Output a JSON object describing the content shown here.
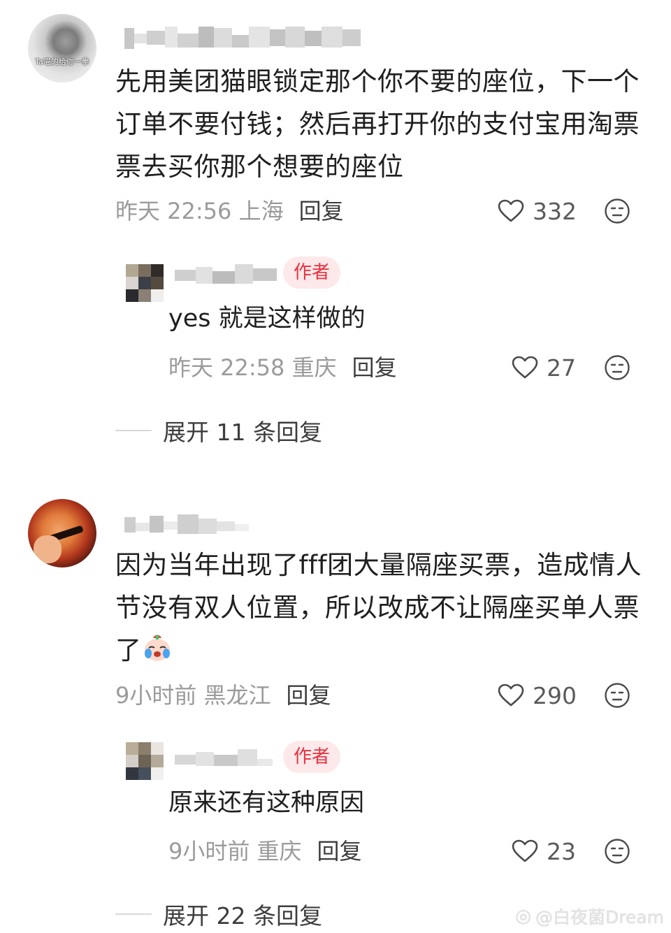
{
  "comments": [
    {
      "avatar_label": "Ta喵的给你一拳",
      "text_lines": [
        "先用美团猫眼锁定那个你不要的座位，下一个",
        "订单不要付钱；然后再打开你的支付宝用淘票",
        "票去买你那个想要的座位"
      ],
      "time": "昨天 22:56 上海",
      "reply_label": "回复",
      "likes": "332",
      "reply": {
        "badge": "作者",
        "text": "yes 就是这样做的",
        "time": "昨天 22:58 重庆",
        "reply_label": "回复",
        "likes": "27"
      },
      "expand_label": "展开 11 条回复"
    },
    {
      "text_lines": [
        "因为当年出现了fff团大量隔座买票，造成情人",
        "节没有双人位置，所以改成不让隔座买单人票",
        "了"
      ],
      "time": "9小时前 黑龙江",
      "reply_label": "回复",
      "likes": "290",
      "reply": {
        "badge": "作者",
        "text": "原来还有这种原因",
        "time": "9小时前 重庆",
        "reply_label": "回复",
        "likes": "23"
      },
      "expand_label": "展开 22 条回复"
    }
  ],
  "watermark": "@白夜菌Dream",
  "icons": {
    "like": "heart-outline-icon",
    "react": "neutral-face-icon",
    "emoji": "crying-face-emoji"
  },
  "colors": {
    "author_badge_bg": "#fde8ea",
    "author_badge_text": "#e8313d"
  }
}
